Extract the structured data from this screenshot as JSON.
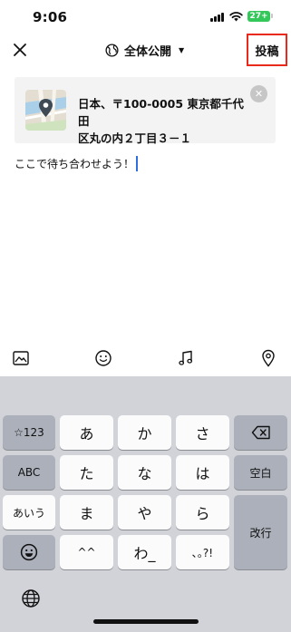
{
  "status_bar": {
    "time": "9:06",
    "battery": "27+"
  },
  "nav": {
    "visibility_label": "全体公開",
    "post_label": "投稿"
  },
  "location": {
    "address_line1": "日本、〒100-0005 東京都千代田",
    "address_line2": "区丸の内２丁目３－１"
  },
  "compose": {
    "text": "ここで待ち合わせよう！"
  },
  "keyboard": {
    "numbers_key": "☆123",
    "abc_key": "ABC",
    "kana_key": "あいう",
    "space_key": "空白",
    "return_key": "改行",
    "keys": {
      "a": "あ",
      "ka": "か",
      "sa": "さ",
      "ta": "た",
      "na": "な",
      "ha": "は",
      "ma": "ま",
      "ya": "や",
      "ra": "ら",
      "kaomoji": "^^",
      "wa": "わ_",
      "punct": "､｡?!"
    }
  },
  "colors": {
    "highlight_border": "#e8291c",
    "caret": "#2f6fdd",
    "battery": "#34c759",
    "keyboard_bg": "#d1d3d9"
  },
  "icons": [
    "close-icon",
    "globe-icon",
    "caret-down-icon",
    "map-pin-icon",
    "image-icon",
    "smiley-icon",
    "music-note-icon",
    "location-pin-icon",
    "backspace-icon",
    "emoji-icon",
    "globe-keyboard-icon"
  ]
}
